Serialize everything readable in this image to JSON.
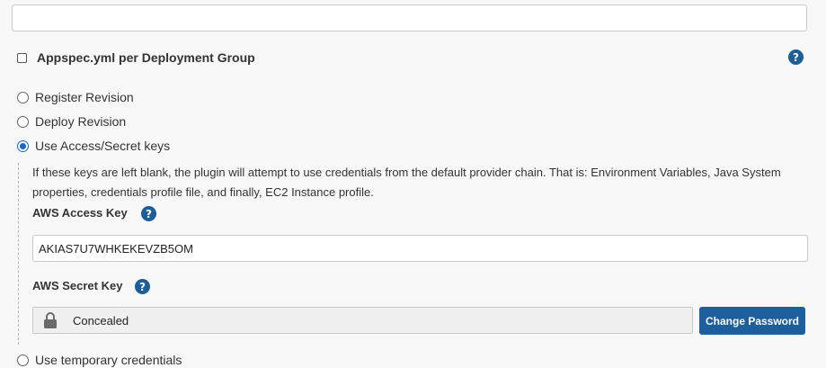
{
  "top_field": {
    "value": ""
  },
  "appspec": {
    "label": "Appspec.yml per Deployment Group",
    "checked": false
  },
  "deploy_options": [
    {
      "label": "Register Revision",
      "selected": false
    },
    {
      "label": "Deploy Revision",
      "selected": false
    },
    {
      "label": "Use Access/Secret keys",
      "selected": true
    },
    {
      "label": "Use temporary credentials",
      "selected": false
    }
  ],
  "keys_description": "If these keys are left blank, the plugin will attempt to use credentials from the default provider chain. That is: Environment Variables, Java System properties, credentials profile file, and finally, EC2 Instance profile.",
  "access_key": {
    "label": "AWS Access Key",
    "value": "AKIAS7U7WHKEKEVZB5OM"
  },
  "secret_key": {
    "label": "AWS Secret Key",
    "value": "Concealed",
    "change_label": "Change Password"
  },
  "help_glyph": "?",
  "colors": {
    "accent": "#1c5f9c",
    "radio_selected": "#1a64c8"
  }
}
